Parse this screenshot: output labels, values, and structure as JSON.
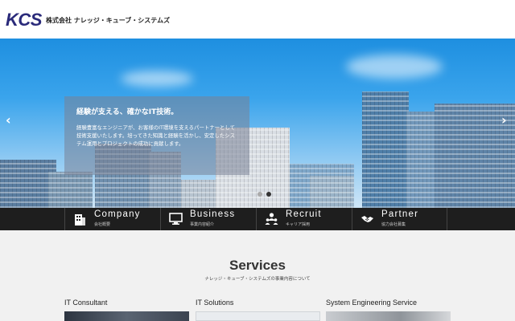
{
  "header": {
    "logo_mark": "KCS",
    "logo_text": "株式会社 ナレッジ・キューブ・システムズ"
  },
  "hero": {
    "title": "経験が支える、確かなIT技術。",
    "body": "経験豊富なエンジニアが、お客様のIT環境を支えるパートナーとして技術支援いたします。培ってきた知識と経験を活かし、安定したシステム運用とプロジェクトの成功に貢献します。",
    "prev_arrow": "‹",
    "next_arrow": "›",
    "slide_count": 2,
    "active_slide": 2
  },
  "nav": {
    "items": [
      {
        "label": "Company",
        "sub": "会社概要",
        "icon": "building-icon"
      },
      {
        "label": "Business",
        "sub": "事業内容紹介",
        "icon": "monitor-icon"
      },
      {
        "label": "Recruit",
        "sub": "キャリア採用",
        "icon": "people-icon"
      },
      {
        "label": "Partner",
        "sub": "協力会社募集",
        "icon": "handshake-icon"
      }
    ]
  },
  "services": {
    "title": "Services",
    "subtitle": "ナレッジ・キューブ・システムズの事業内容について",
    "cards": [
      {
        "label": "IT Consultant"
      },
      {
        "label": "IT Solutions"
      },
      {
        "label": "System Engineering Service"
      }
    ]
  },
  "colors": {
    "brand": "#2a2a7a",
    "nav_bg": "#1e1e1e",
    "services_bg": "#f1f1f1"
  }
}
